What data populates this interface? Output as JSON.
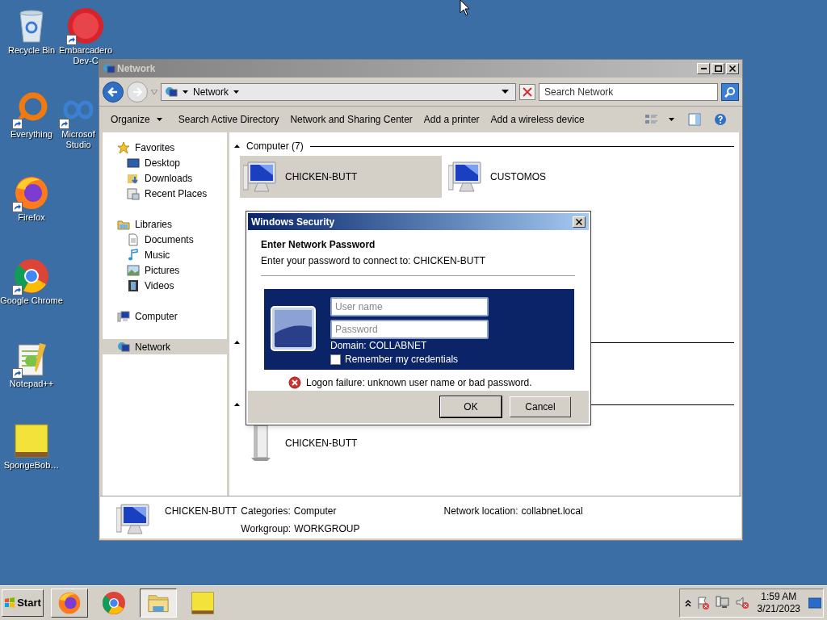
{
  "desktop_icons": [
    {
      "lines": [
        "Recycle Bin"
      ],
      "shortcut": false
    },
    {
      "lines": [
        "Embarcadero",
        "Dev-C"
      ],
      "shortcut": true
    },
    {
      "lines": [
        "Everything"
      ],
      "shortcut": true
    },
    {
      "lines": [
        "Microsof",
        "Studio"
      ],
      "shortcut": true
    },
    {
      "lines": [
        "Firefox"
      ],
      "shortcut": true
    },
    {
      "lines": [
        "Google Chrome"
      ],
      "shortcut": true
    },
    {
      "lines": [
        "Notepad++"
      ],
      "shortcut": true
    },
    {
      "lines": [
        "SpongeBob…"
      ],
      "shortcut": false
    }
  ],
  "window": {
    "title": "Network",
    "active": false,
    "address": {
      "crumbs": [
        "Network"
      ]
    },
    "search": {
      "placeholder": "Search Network"
    },
    "commands": [
      {
        "label": "Organize",
        "dropdown": true
      },
      {
        "label": "Search Active Directory",
        "dropdown": false
      },
      {
        "label": "Network and Sharing Center",
        "dropdown": false
      },
      {
        "label": "Add a printer",
        "dropdown": false
      },
      {
        "label": "Add a wireless device",
        "dropdown": false
      }
    ],
    "nav_pane": [
      {
        "label": "Favorites",
        "selected": false,
        "children": [
          {
            "label": "Desktop",
            "selected": false
          },
          {
            "label": "Downloads",
            "selected": false
          },
          {
            "label": "Recent Places",
            "selected": false
          }
        ]
      },
      {
        "label": "Libraries",
        "selected": false,
        "children": [
          {
            "label": "Documents",
            "selected": false
          },
          {
            "label": "Music",
            "selected": false
          },
          {
            "label": "Pictures",
            "selected": false
          },
          {
            "label": "Videos",
            "selected": false
          }
        ]
      },
      {
        "label": "Computer",
        "selected": false
      },
      {
        "label": "Network",
        "selected": true
      }
    ],
    "groups": [
      {
        "title": "Computer (7)",
        "expanded": true,
        "items": [
          {
            "name": "CHICKEN-BUTT",
            "kind": "monitor",
            "selected": true
          },
          {
            "name": "CUSTOMOS",
            "kind": "monitor",
            "selected": false
          }
        ]
      },
      {
        "expanded": true
      },
      {
        "expanded": true,
        "items": [
          {
            "name": "CHICKEN-BUTT",
            "kind": "tower",
            "selected": false
          }
        ]
      }
    ],
    "details": {
      "name": "CHICKEN-BUTT",
      "fields": [
        {
          "label": "Categories:",
          "value": "Computer"
        },
        {
          "label": "Workgroup:",
          "value": "WORKGROUP"
        },
        {
          "label": "Network location:",
          "value": "collabnet.local"
        }
      ]
    }
  },
  "dialog": {
    "title": "Windows Security",
    "heading": "Enter Network Password",
    "subtitle": "Enter your password to connect to: CHICKEN-BUTT",
    "username": {
      "placeholder": "User name"
    },
    "password": {
      "placeholder": "Password"
    },
    "domain": "Domain: COLLABNET",
    "remember": {
      "label": "Remember my credentials",
      "checked": false
    },
    "error": "Logon failure: unknown user name or bad password.",
    "buttons": [
      {
        "label": "OK",
        "default": true
      },
      {
        "label": "Cancel",
        "default": false
      }
    ]
  },
  "taskbar": {
    "start": "Start",
    "tasks": [
      {
        "active": false
      },
      {
        "active": false
      },
      {
        "active": true
      },
      {
        "active": false
      }
    ],
    "clock": {
      "time": "1:59 AM",
      "date": "3/21/2023"
    }
  }
}
